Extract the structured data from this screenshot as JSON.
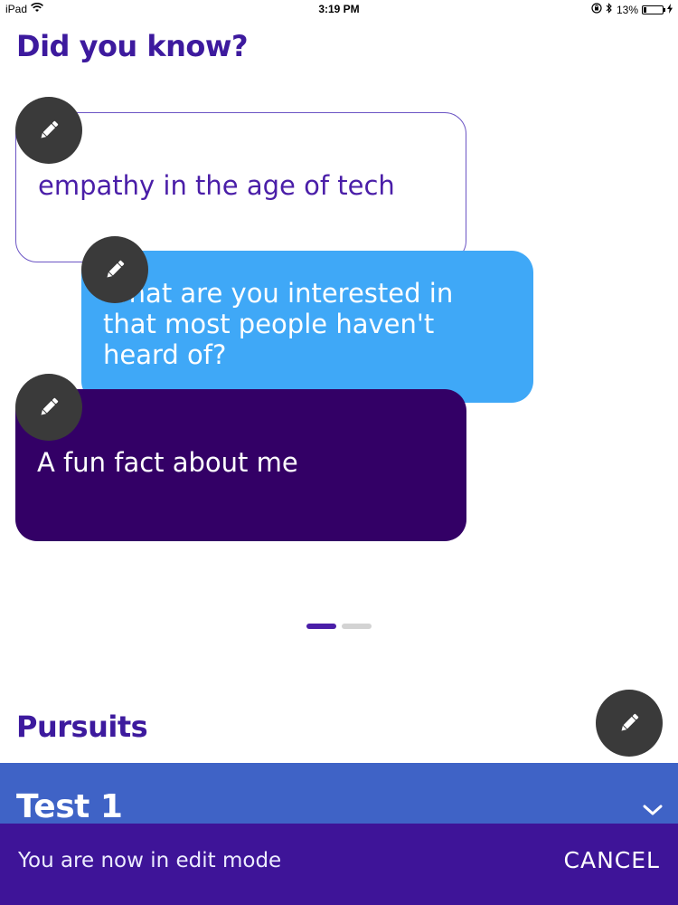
{
  "status_bar": {
    "device": "iPad",
    "time": "3:19 PM",
    "battery": "13%"
  },
  "did_you_know": {
    "title": "Did you know?",
    "cards": [
      {
        "text": "empathy in the age of tech"
      },
      {
        "text": "What are you interested in that most people haven't heard of?"
      },
      {
        "text": "A fun fact about me"
      }
    ],
    "pager": {
      "active_page": 1,
      "total_pages": 2
    }
  },
  "pursuits": {
    "title": "Pursuits",
    "items": [
      {
        "title": "Test 1"
      }
    ]
  },
  "edit_mode": {
    "message": "You are now in edit mode",
    "cancel_label": "CANCEL"
  },
  "colors": {
    "heading": "#3d1a9e",
    "card_blue": "#3fa8f7",
    "card_dark_purple": "#330066",
    "pursuit_bar": "#3f63c6",
    "edit_bar": "#3e1498",
    "edit_circle": "#3a3a3a"
  },
  "icons": {
    "edit": "pencil-icon",
    "wifi": "wifi-icon",
    "bluetooth": "bluetooth-icon",
    "battery": "battery-icon",
    "charging": "charging-icon",
    "lock_rotation": "orientation-lock-icon",
    "expand": "chevron-down-icon"
  }
}
